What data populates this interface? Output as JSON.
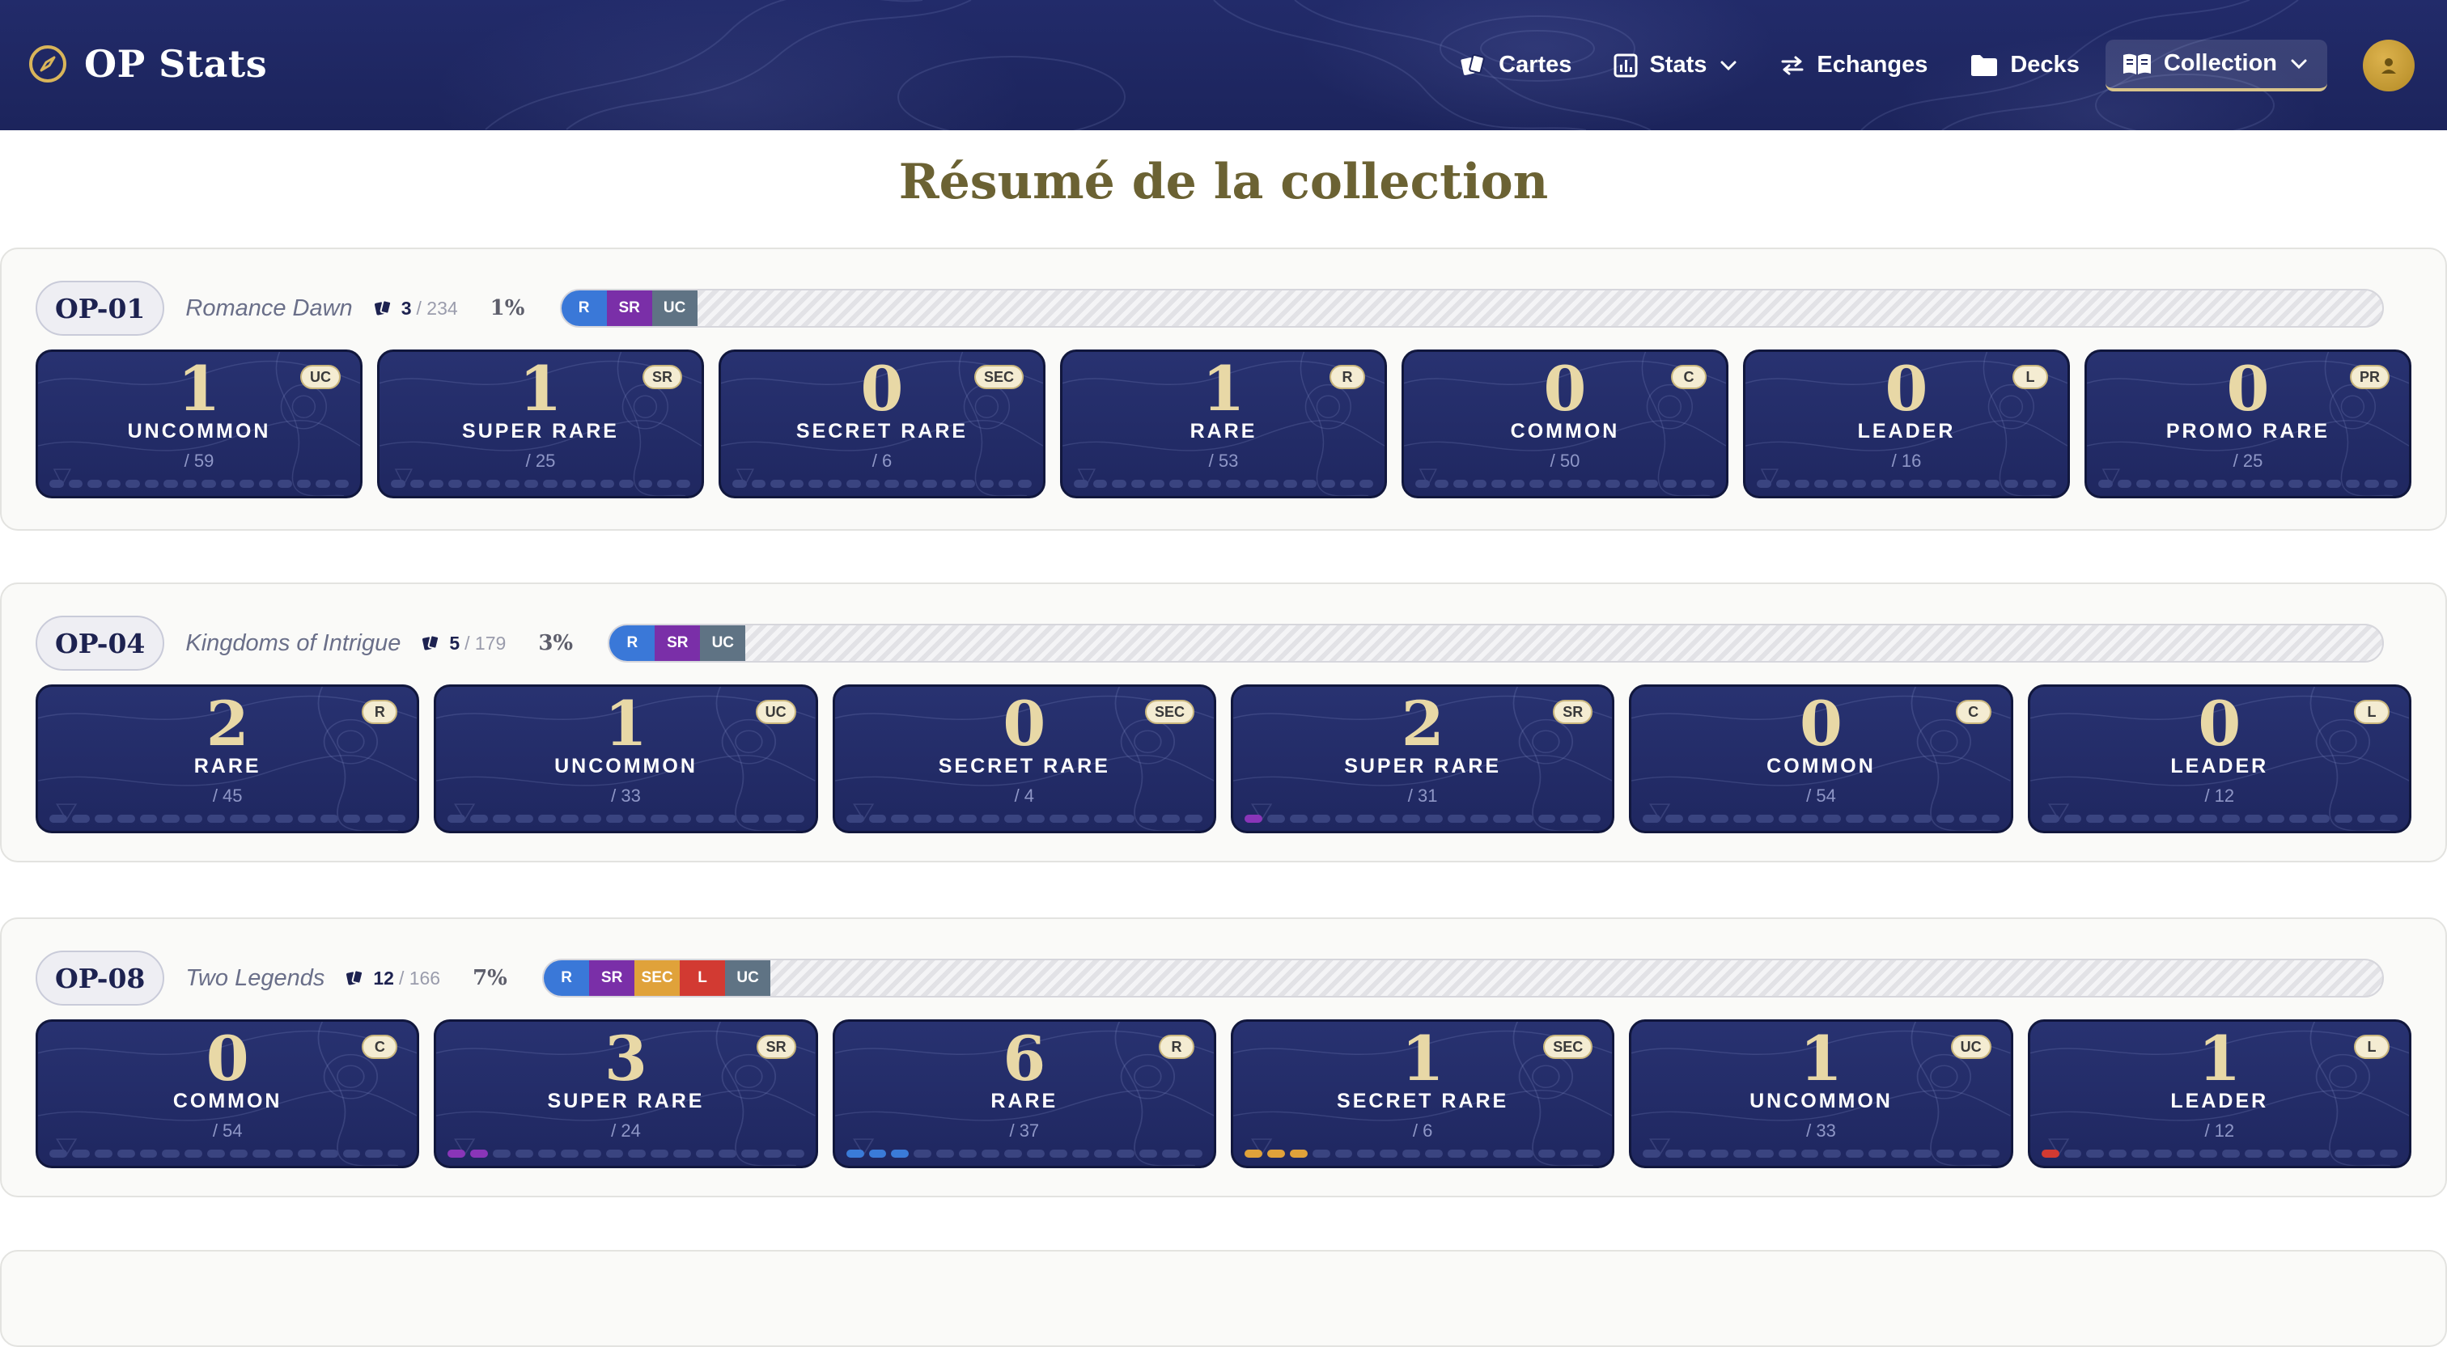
{
  "nav": {
    "brand": "OP Stats",
    "items": [
      {
        "label": "Cartes",
        "icon": "cards-icon"
      },
      {
        "label": "Stats",
        "icon": "bar-chart-icon",
        "dropdown": true
      },
      {
        "label": "Echanges",
        "icon": "swap-arrows-icon"
      },
      {
        "label": "Decks",
        "icon": "folder-icon"
      },
      {
        "label": "Collection",
        "icon": "open-book-icon",
        "dropdown": true,
        "active": true
      }
    ]
  },
  "page": {
    "title": "Résumé de la collection"
  },
  "sets": [
    {
      "code": "OP-01",
      "name": "Romance Dawn",
      "owned": "3",
      "total": "/ 234",
      "percent": "1%",
      "progress": [
        {
          "label": "R",
          "cls": "r"
        },
        {
          "label": "SR",
          "cls": "sr"
        },
        {
          "label": "UC",
          "cls": "uc"
        }
      ],
      "cards": [
        {
          "count": "1",
          "label": "UNCOMMON",
          "total": "/ 59",
          "badge": "UC",
          "color": "#5f7384",
          "level": 0.0
        },
        {
          "count": "1",
          "label": "SUPER RARE",
          "total": "/ 25",
          "badge": "SR",
          "color": "#8a35b8",
          "level": 0.0
        },
        {
          "count": "0",
          "label": "SECRET RARE",
          "total": "/ 6",
          "badge": "SEC",
          "color": "#e0a23a",
          "level": 0.0
        },
        {
          "count": "1",
          "label": "RARE",
          "total": "/ 53",
          "badge": "R",
          "color": "#3a7bd8",
          "level": 0.0
        },
        {
          "count": "0",
          "label": "COMMON",
          "total": "/ 50",
          "badge": "C",
          "color": "#5f7384",
          "level": 0.0
        },
        {
          "count": "0",
          "label": "LEADER",
          "total": "/ 16",
          "badge": "L",
          "color": "#d23a32",
          "level": 0.0
        },
        {
          "count": "0",
          "label": "PROMO RARE",
          "total": "/ 25",
          "badge": "PR",
          "color": "#5f7384",
          "level": 0.0
        }
      ]
    },
    {
      "code": "OP-04",
      "name": "Kingdoms of Intrigue",
      "owned": "5",
      "total": "/ 179",
      "percent": "3%",
      "progress": [
        {
          "label": "R",
          "cls": "r"
        },
        {
          "label": "SR",
          "cls": "sr"
        },
        {
          "label": "UC",
          "cls": "uc"
        }
      ],
      "cards": [
        {
          "count": "2",
          "label": "RARE",
          "total": "/ 45",
          "badge": "R",
          "color": "#3a7bd8",
          "level": 0.0
        },
        {
          "count": "1",
          "label": "UNCOMMON",
          "total": "/ 33",
          "badge": "UC",
          "color": "#5f7384",
          "level": 0.0
        },
        {
          "count": "0",
          "label": "SECRET RARE",
          "total": "/ 4",
          "badge": "SEC",
          "color": "#e0a23a",
          "level": 0.0
        },
        {
          "count": "2",
          "label": "SUPER RARE",
          "total": "/ 31",
          "badge": "SR",
          "color": "#8a35b8",
          "level": 0.065
        },
        {
          "count": "0",
          "label": "COMMON",
          "total": "/ 54",
          "badge": "C",
          "color": "#5f7384",
          "level": 0.0
        },
        {
          "count": "0",
          "label": "LEADER",
          "total": "/ 12",
          "badge": "L",
          "color": "#d23a32",
          "level": 0.0
        }
      ]
    },
    {
      "code": "OP-08",
      "name": "Two Legends",
      "owned": "12",
      "total": "/ 166",
      "percent": "7%",
      "progress": [
        {
          "label": "R",
          "cls": "r"
        },
        {
          "label": "SR",
          "cls": "sr"
        },
        {
          "label": "SEC",
          "cls": "sec"
        },
        {
          "label": "L",
          "cls": "l"
        },
        {
          "label": "UC",
          "cls": "uc"
        }
      ],
      "cards": [
        {
          "count": "0",
          "label": "COMMON",
          "total": "/ 54",
          "badge": "C",
          "color": "#5f7384",
          "level": 0.0
        },
        {
          "count": "3",
          "label": "SUPER RARE",
          "total": "/ 24",
          "badge": "SR",
          "color": "#8a35b8",
          "level": 0.125
        },
        {
          "count": "6",
          "label": "RARE",
          "total": "/ 37",
          "badge": "R",
          "color": "#3a7bd8",
          "level": 0.162
        },
        {
          "count": "1",
          "label": "SECRET RARE",
          "total": "/ 6",
          "badge": "SEC",
          "color": "#e0a23a",
          "level": 0.167
        },
        {
          "count": "1",
          "label": "UNCOMMON",
          "total": "/ 33",
          "badge": "UC",
          "color": "#5f7384",
          "level": 0.0
        },
        {
          "count": "1",
          "label": "LEADER",
          "total": "/ 12",
          "badge": "L",
          "color": "#d23a32",
          "level": 0.083
        }
      ]
    }
  ]
}
